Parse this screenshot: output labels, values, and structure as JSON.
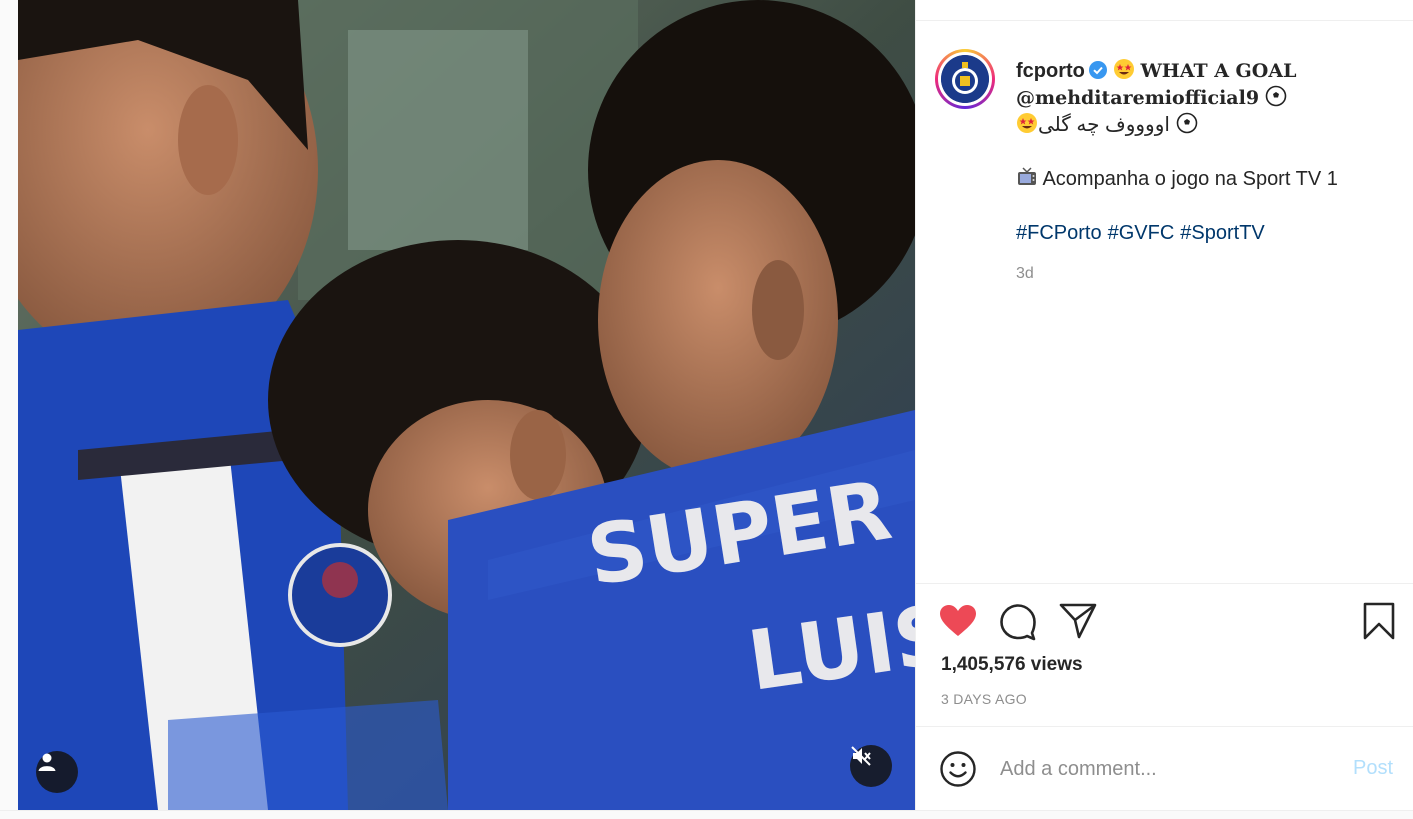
{
  "media": {
    "jersey_text_line1": "SUPER",
    "jersey_text_line2": "LUIS"
  },
  "post": {
    "username": "fcporto",
    "caption_headline": "WHAT A GOAL",
    "caption_mention": "@mehditaremiofficial9",
    "caption_persian": "اووووف چه گلی",
    "caption_tv": "Acompanha o jogo na Sport TV 1",
    "hashtags": [
      "#FCPorto",
      "#GVFC",
      "#SportTV"
    ],
    "time_ago": "3d"
  },
  "stats": {
    "views": "1,405,576 views",
    "posted": "3 DAYS AGO"
  },
  "comment": {
    "placeholder": "Add a comment...",
    "post_label": "Post"
  },
  "colors": {
    "like": "#ed4956",
    "hashtag": "#00376b",
    "verified": "#3897f0",
    "post_disabled": "#b2dffc"
  },
  "icons": {
    "like": "heart-filled-icon",
    "comment": "comment-bubble-icon",
    "share": "paper-plane-icon",
    "save": "bookmark-icon",
    "emoji": "smiley-icon",
    "mute": "speaker-muted-icon",
    "user_tag": "user-icon"
  }
}
